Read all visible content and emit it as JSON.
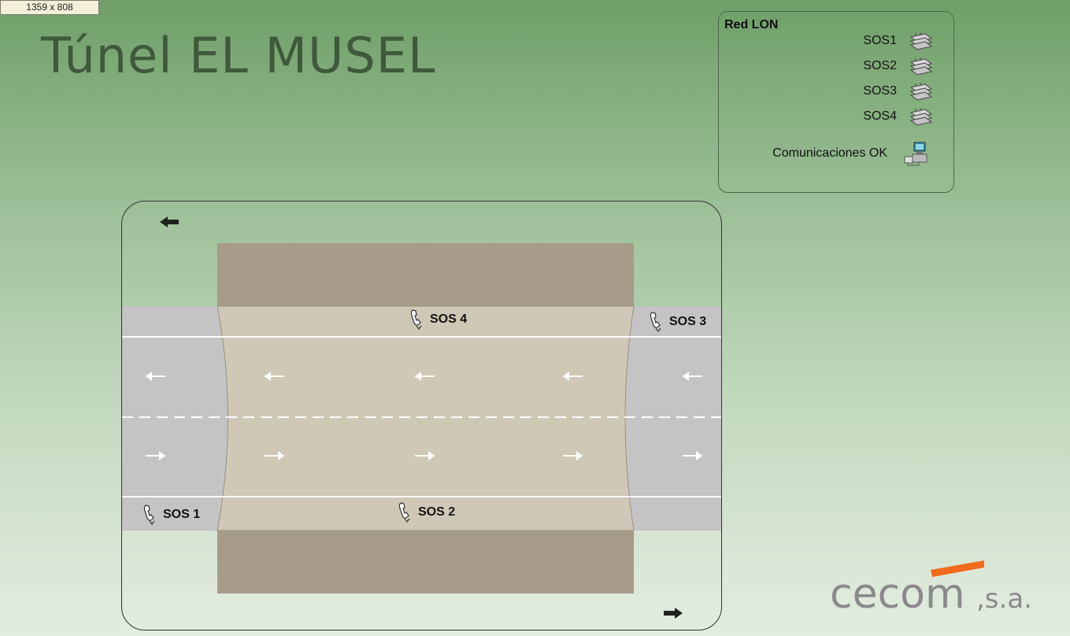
{
  "window": {
    "dimensions_label": "1359 x 808"
  },
  "header": {
    "title": "Túnel EL MUSEL"
  },
  "network_panel": {
    "title": "Red LON",
    "nodes": [
      {
        "label": "SOS1",
        "icon": "network-node-icon"
      },
      {
        "label": "SOS2",
        "icon": "network-node-icon"
      },
      {
        "label": "SOS3",
        "icon": "network-node-icon"
      },
      {
        "label": "SOS4",
        "icon": "network-node-icon"
      }
    ],
    "communications": {
      "label": "Comunicaciones OK",
      "icon": "computer-network-icon"
    }
  },
  "tunnel": {
    "sos_points": [
      {
        "label": "SOS 4"
      },
      {
        "label": "SOS 3"
      },
      {
        "label": "SOS 1"
      },
      {
        "label": "SOS 2"
      }
    ],
    "direction_top": "left",
    "direction_bottom": "right"
  },
  "logo": {
    "text": "cecom",
    "suffix": ",s.a.",
    "accent_color": "#f26a1b",
    "text_color": "#8a8a8a"
  },
  "colors": {
    "background_top": "#6f9f68",
    "background_bottom": "#e3ede0",
    "road": "#c4c4c4",
    "tunnel_floor": "#cfc8b6",
    "tunnel_wall": "#a79b89"
  }
}
